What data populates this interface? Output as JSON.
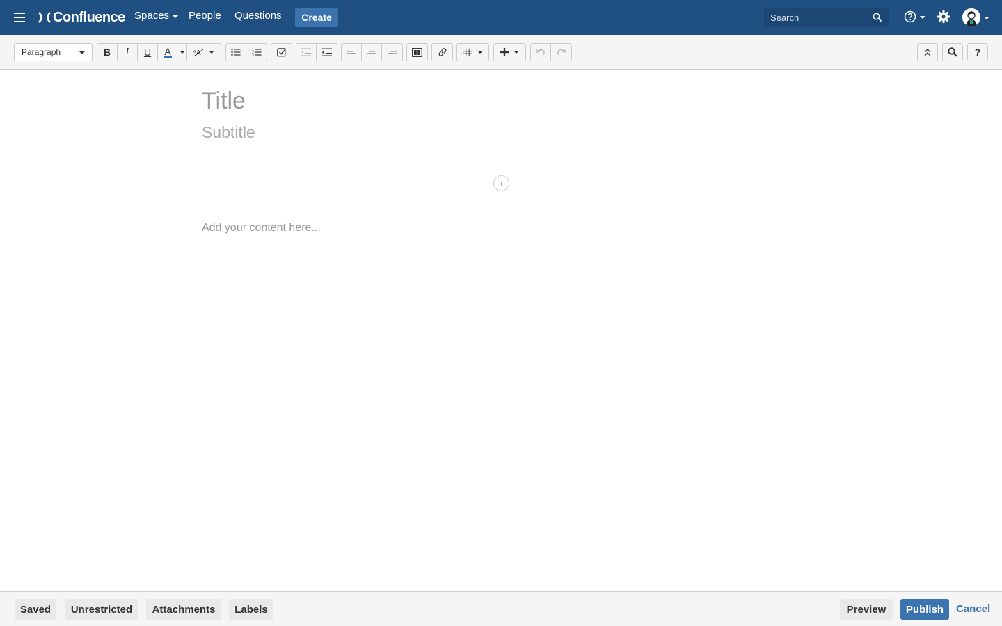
{
  "header": {
    "logo_text": "Confluence",
    "nav": {
      "spaces": "Spaces",
      "people": "People",
      "questions": "Questions"
    },
    "create_label": "Create",
    "search_placeholder": "Search"
  },
  "toolbar": {
    "paragraph_style": "Paragraph",
    "bold": "B",
    "italic": "I",
    "underline": "U",
    "text_color": "A",
    "help": "?"
  },
  "editor": {
    "title_placeholder": "Title",
    "subtitle_placeholder": "Subtitle",
    "add_layout": "+",
    "content_placeholder": "Add your content here..."
  },
  "footer": {
    "saved": "Saved",
    "unrestricted": "Unrestricted",
    "attachments": "Attachments",
    "labels": "Labels",
    "preview": "Preview",
    "publish": "Publish",
    "cancel": "Cancel"
  },
  "colors": {
    "header_bg": "#205081",
    "accent": "#3b73af",
    "text_color_indicator": "#3b73af"
  }
}
